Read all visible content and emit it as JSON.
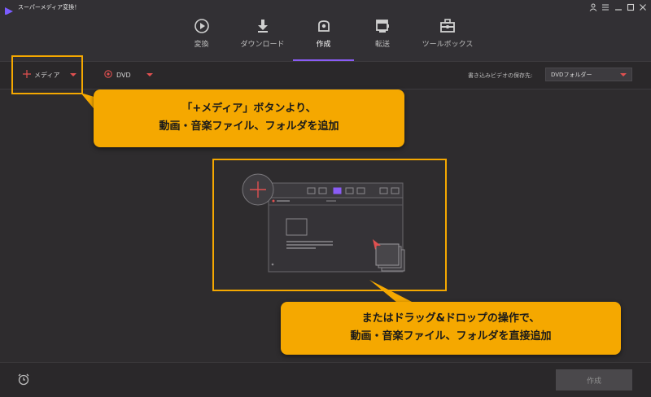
{
  "app": {
    "title": "スーパーメディア変換！"
  },
  "nav": {
    "items": [
      {
        "label": "変換",
        "icon": "convert-icon",
        "active": false
      },
      {
        "label": "ダウンロード",
        "icon": "download-icon",
        "active": false
      },
      {
        "label": "作成",
        "icon": "burn-disc-icon",
        "active": true
      },
      {
        "label": "転送",
        "icon": "transfer-icon",
        "active": false
      },
      {
        "label": "ツールボックス",
        "icon": "toolbox-icon",
        "active": false
      }
    ]
  },
  "toolbar": {
    "media_label": "メディア",
    "dvd_label": "DVD",
    "save_label": "書き込みビデオの保存先:",
    "save_value": "DVDフォルダー"
  },
  "callouts": {
    "top": [
      "「+メディア」ボタンより、",
      "動画・音楽ファイル、フォルダを追加"
    ],
    "bottom": [
      "またはドラッグ&ドロップの操作で、",
      "動画・音楽ファイル、フォルダを直接追加"
    ]
  },
  "footer": {
    "create_label": "作成"
  },
  "colors": {
    "accent": "#8a5cf5",
    "highlight": "#f5a800",
    "media_red": "#e05050"
  }
}
